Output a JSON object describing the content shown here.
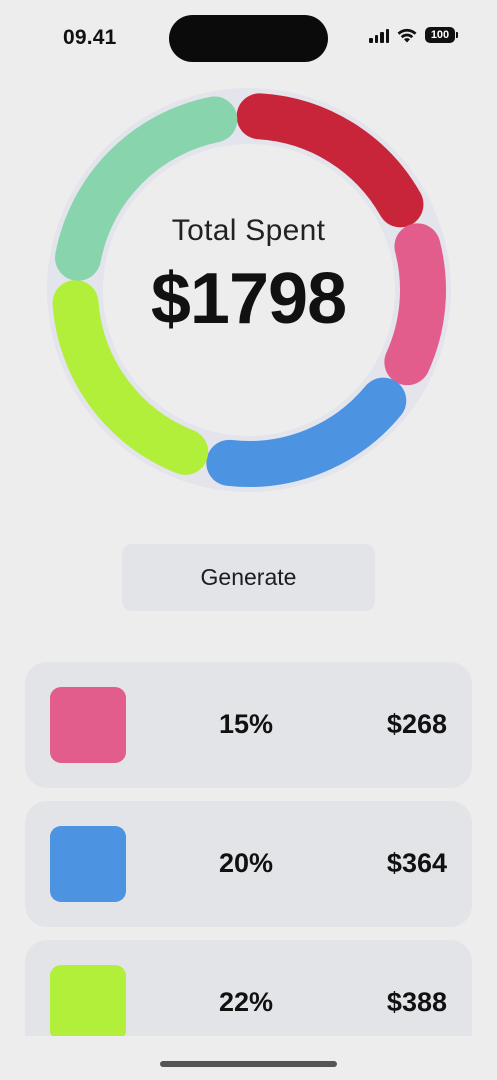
{
  "status_bar": {
    "time": "09.41",
    "battery": "100",
    "icons": [
      "signal-icon",
      "wifi-icon",
      "battery-icon"
    ]
  },
  "donut": {
    "label": "Total Spent",
    "total": "$1798",
    "track_color": "#e3e4ec",
    "segments": [
      {
        "name": "red",
        "color": "#c9253a",
        "fraction": 0.2
      },
      {
        "name": "pink",
        "color": "#e35d8c",
        "fraction": 0.15
      },
      {
        "name": "blue",
        "color": "#4c93e2",
        "fraction": 0.2
      },
      {
        "name": "lime",
        "color": "#b2ef3a",
        "fraction": 0.22
      },
      {
        "name": "mint",
        "color": "#88d4ac",
        "fraction": 0.23
      }
    ]
  },
  "generate_button": {
    "label": "Generate"
  },
  "items": [
    {
      "color": "#e35d8c",
      "percent": "15%",
      "amount": "$268"
    },
    {
      "color": "#4c93e2",
      "percent": "20%",
      "amount": "$364"
    },
    {
      "color": "#b2ef3a",
      "percent": "22%",
      "amount": "$388"
    }
  ]
}
